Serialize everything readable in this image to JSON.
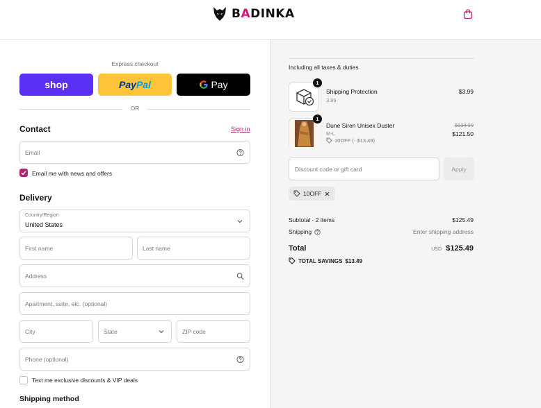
{
  "header": {
    "brand_prefix": "B",
    "brand_accent": "A",
    "brand_suffix": "DINKA",
    "bag_icon": "shopping-bag-icon"
  },
  "colors": {
    "accent": "#b3246e",
    "shop_pay": "#5a31f4",
    "paypal": "#ffc439",
    "gpay": "#000000"
  },
  "express": {
    "label": "Express checkout",
    "shop_label": "shop",
    "paypal_part1": "Pay",
    "paypal_part2": "Pal",
    "gpay_label": "Pay",
    "or_label": "OR"
  },
  "contact": {
    "title": "Contact",
    "sign_in": "Sign in",
    "email_placeholder": "Email",
    "newsletter_label": "Email me with news and offers",
    "newsletter_checked": true
  },
  "delivery": {
    "title": "Delivery",
    "country_label": "Country/Region",
    "country_value": "United States",
    "first_name_placeholder": "First name",
    "last_name_placeholder": "Last name",
    "address_placeholder": "Address",
    "apartment_placeholder": "Apartment, suite, etc. (optional)",
    "city_placeholder": "City",
    "state_placeholder": "State",
    "zip_placeholder": "ZIP code",
    "phone_placeholder": "Phone (optional)",
    "sms_label": "Text me exclusive discounts & VIP deals",
    "sms_checked": false
  },
  "shipping_method": {
    "title": "Shipping method"
  },
  "summary": {
    "taxes_note": "Including all taxes & duties",
    "items": [
      {
        "name": "Shipping Protection",
        "sub": "3.99",
        "qty": "1",
        "price": "$3.99"
      },
      {
        "name": "Dune Siren Unisex Duster",
        "sub": "M-L",
        "qty": "1",
        "discount": "10OFF (- $13.49)",
        "original_price": "$134.99",
        "price": "$121.50"
      }
    ],
    "code_placeholder": "Discount code or gift card",
    "apply_label": "Apply",
    "applied_code": "10OFF",
    "subtotal_label": "Subtotal · 2 items",
    "subtotal_value": "$125.49",
    "shipping_label": "Shipping",
    "shipping_value": "Enter shipping address",
    "total_label": "Total",
    "total_currency": "USD",
    "total_value": "$125.49",
    "savings_label": "TOTAL SAVINGS",
    "savings_value": "$13.49"
  }
}
